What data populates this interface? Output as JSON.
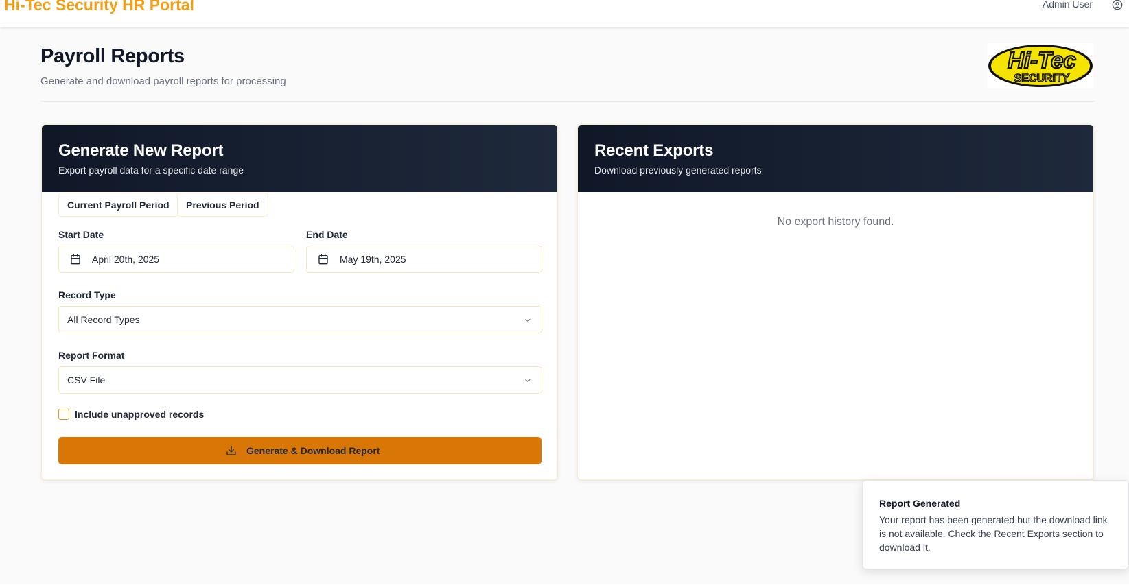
{
  "topbar": {
    "brand": "Hi-Tec Security HR Portal",
    "user_name": "Admin User",
    "user_icon": "user-circle-icon"
  },
  "header": {
    "title": "Payroll Reports",
    "subtitle": "Generate and download payroll reports for processing",
    "logo": {
      "line1": "Hi-Tec",
      "line2": "SECURITY"
    }
  },
  "generate": {
    "title": "Generate New Report",
    "subtitle": "Export payroll data for a specific date range",
    "quick_buttons": [
      "Current Payroll Period",
      "Previous Period"
    ],
    "start_date": {
      "label": "Start Date",
      "value": "April 20th, 2025",
      "icon": "calendar-icon"
    },
    "end_date": {
      "label": "End Date",
      "value": "May 19th, 2025",
      "icon": "calendar-icon"
    },
    "record_type": {
      "label": "Record Type",
      "value": "All Record Types",
      "icon": "chevron-down-icon"
    },
    "report_format": {
      "label": "Report Format",
      "value": "CSV File",
      "icon": "chevron-down-icon"
    },
    "include_unapproved": {
      "label": "Include unapproved records",
      "checked": false
    },
    "submit": {
      "label": "Generate & Download Report",
      "icon": "download-icon"
    }
  },
  "recent": {
    "title": "Recent Exports",
    "subtitle": "Download previously generated reports",
    "empty_message": "No export history found."
  },
  "toast": {
    "title": "Report Generated",
    "body": "Your report has been generated but the download link is not available. Check the Recent Exports section to download it."
  },
  "colors": {
    "brand": "#f29d12",
    "accent": "#d97706",
    "card_header": "#101828",
    "border": "#fbeccc"
  }
}
